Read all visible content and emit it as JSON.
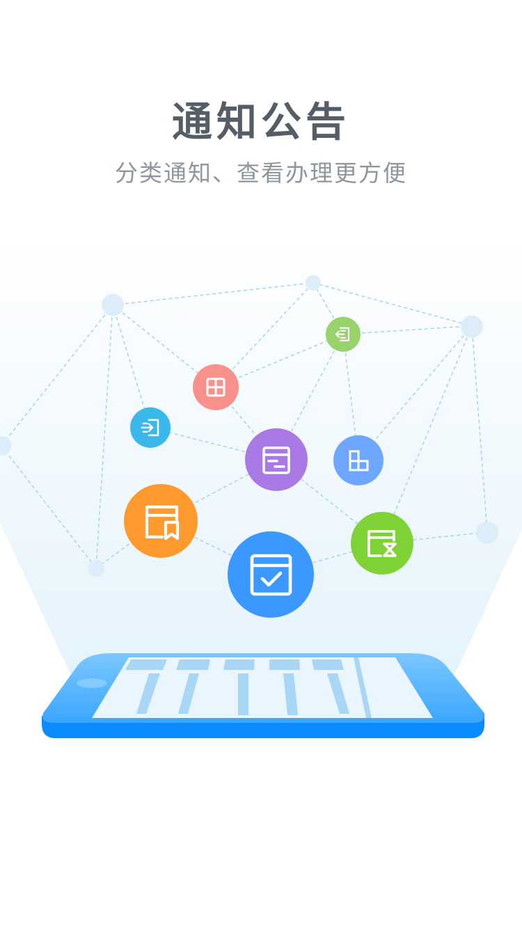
{
  "guide": {
    "title": "通知公告",
    "subtitle": "分类通知、查看办理更方便"
  },
  "colors": {
    "title": "#555e66",
    "subtitle": "#8e979f",
    "beam_top": "#ffffff",
    "beam_bottom": "#e2f2fb",
    "network_line": "#9fd0f2",
    "network_dot": "#dcecf9",
    "phone_body": "#5ab6ff",
    "phone_edge": "#0a8cff",
    "phone_screen": "#e9f6fd",
    "phone_bars": "#a9d6f4"
  },
  "icons": [
    {
      "name": "check-calendar-icon",
      "color": "#3b98ff"
    },
    {
      "name": "bookmark-doc-icon",
      "color": "#ff9a2f"
    },
    {
      "name": "document-icon",
      "color": "#a97ae6"
    },
    {
      "name": "hourglass-doc-icon",
      "color": "#7ed236"
    },
    {
      "name": "grid-icon",
      "color": "#f8918c"
    },
    {
      "name": "login-icon",
      "color": "#3ab8ea"
    },
    {
      "name": "blocks-icon",
      "color": "#6ea7ff"
    },
    {
      "name": "logout-icon",
      "color": "#97d26c"
    }
  ]
}
